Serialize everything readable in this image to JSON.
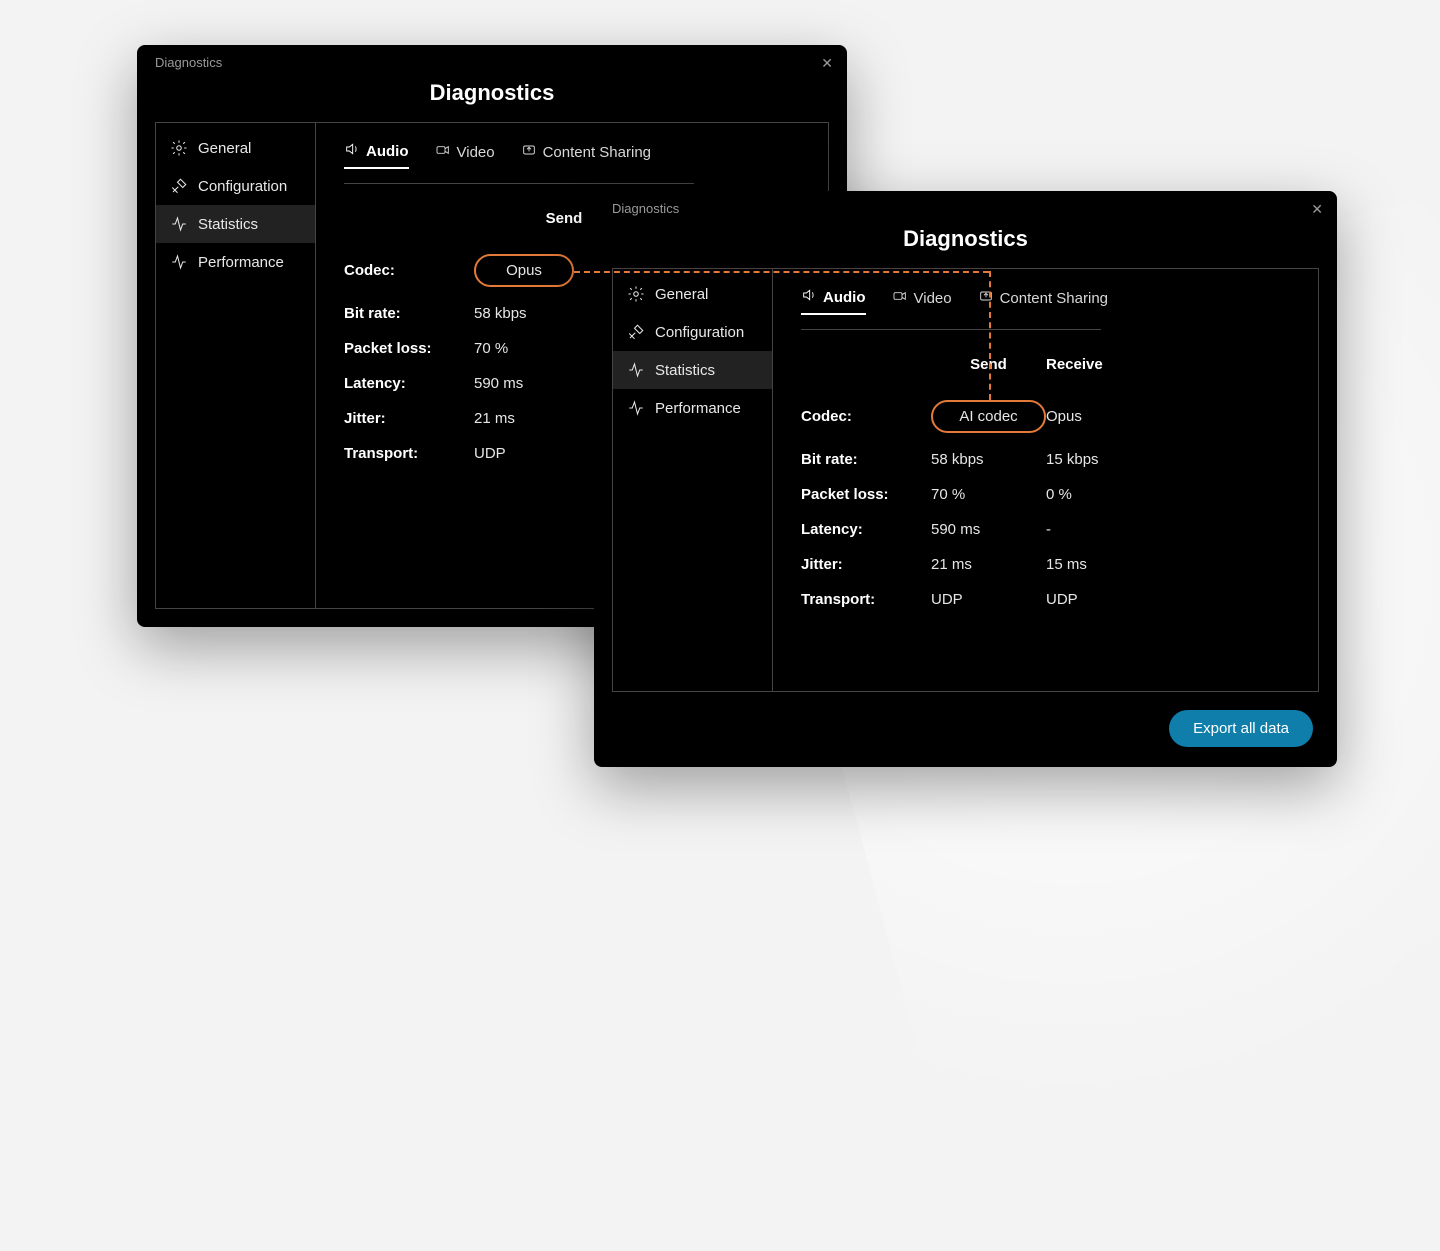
{
  "accent": "#e37a3a",
  "window1": {
    "titlebar": "Diagnostics",
    "heading": "Diagnostics",
    "sidebar": {
      "items": [
        {
          "label": "General"
        },
        {
          "label": "Configuration"
        },
        {
          "label": "Statistics",
          "active": true
        },
        {
          "label": "Performance"
        }
      ]
    },
    "tabs": [
      {
        "label": "Audio",
        "active": true
      },
      {
        "label": "Video"
      },
      {
        "label": "Content Sharing"
      }
    ],
    "columns": {
      "send": "Send"
    },
    "rows": [
      {
        "label": "Codec:",
        "send": "Opus",
        "highlight": true
      },
      {
        "label": "Bit rate:",
        "send": "58 kbps"
      },
      {
        "label": "Packet loss:",
        "send": "70 %"
      },
      {
        "label": "Latency:",
        "send": "590 ms"
      },
      {
        "label": "Jitter:",
        "send": "21 ms"
      },
      {
        "label": "Transport:",
        "send": "UDP"
      }
    ]
  },
  "window2": {
    "titlebar": "Diagnostics",
    "heading": "Diagnostics",
    "sidebar": {
      "items": [
        {
          "label": "General"
        },
        {
          "label": "Configuration"
        },
        {
          "label": "Statistics",
          "active": true
        },
        {
          "label": "Performance"
        }
      ]
    },
    "tabs": [
      {
        "label": "Audio",
        "active": true
      },
      {
        "label": "Video"
      },
      {
        "label": "Content Sharing"
      }
    ],
    "columns": {
      "send": "Send",
      "receive": "Receive"
    },
    "rows": [
      {
        "label": "Codec:",
        "send": "AI codec",
        "receive": "Opus",
        "highlight": true
      },
      {
        "label": "Bit rate:",
        "send": "58 kbps",
        "receive": "15 kbps"
      },
      {
        "label": "Packet loss:",
        "send": "70 %",
        "receive": "0 %"
      },
      {
        "label": "Latency:",
        "send": "590 ms",
        "receive": "-"
      },
      {
        "label": "Jitter:",
        "send": "21 ms",
        "receive": "15 ms"
      },
      {
        "label": "Transport:",
        "send": "UDP",
        "receive": "UDP"
      }
    ],
    "export_label": "Export all data"
  }
}
